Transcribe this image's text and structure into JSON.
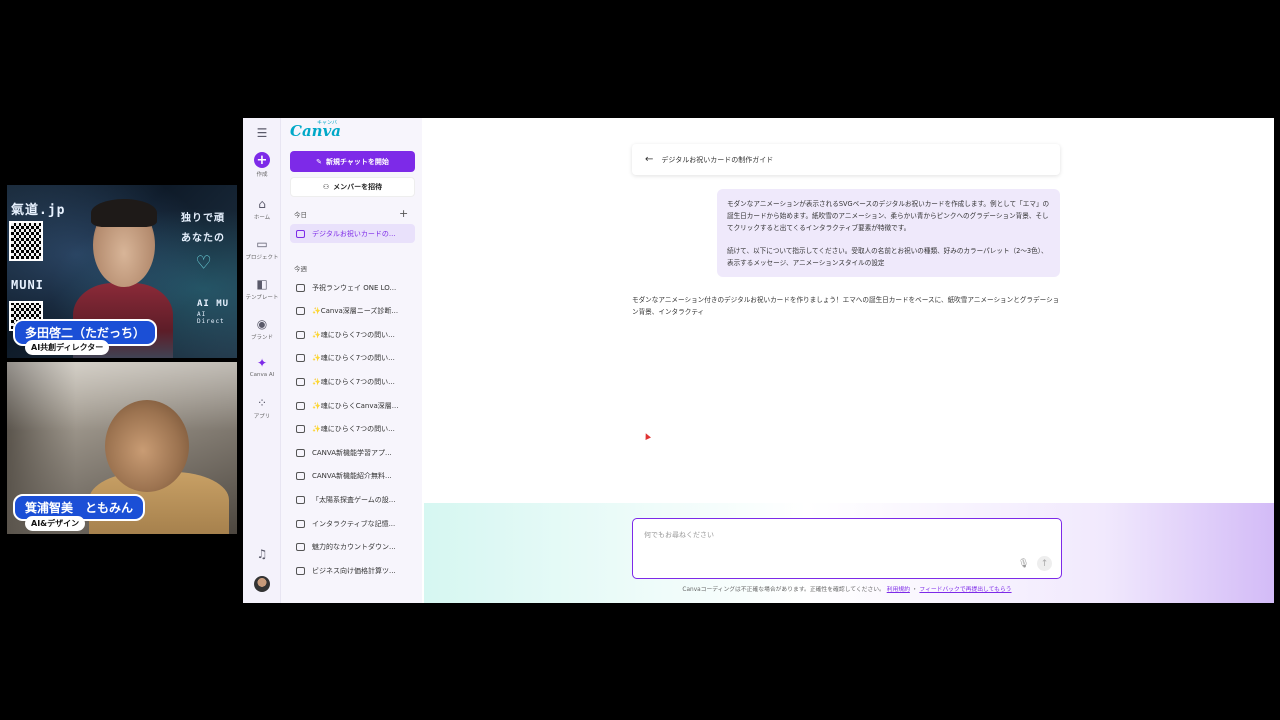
{
  "cam1": {
    "watermark_top": "氣道.jp",
    "watermark_mid": "MUNI",
    "watermark_right1": "独りで頑",
    "watermark_right2": "あなたの",
    "watermark_ai": "AI MU",
    "watermark_ai_sub": "AI Direct",
    "name": "多田啓二（ただっち）",
    "role": "AI共創ディレクター"
  },
  "cam2": {
    "name": "箕浦智美　ともみん",
    "role": "AI&デザイン"
  },
  "canva": {
    "logo": "Canva",
    "logo_kana": "キャンバ",
    "rail": [
      {
        "label": "作成",
        "icon": "plus-icon"
      },
      {
        "label": "ホーム",
        "icon": "home-icon"
      },
      {
        "label": "プロジェクト",
        "icon": "folder-icon"
      },
      {
        "label": "テンプレート",
        "icon": "template-icon"
      },
      {
        "label": "ブランド",
        "icon": "brand-icon"
      },
      {
        "label": "Canva AI",
        "icon": "sparkle-icon"
      },
      {
        "label": "アプリ",
        "icon": "apps-icon"
      }
    ],
    "new_chat": "新規チャットを開始",
    "invite": "メンバーを招待",
    "today_label": "今日",
    "week_label": "今週",
    "today_items": [
      "デジタルお祝いカードの..."
    ],
    "week_items": [
      "予祝ランウェイ ONE LO...",
      "✨Canva深層ニーズ診断...",
      "✨魂にひらく7つの問い...",
      "✨魂にひらく7つの問い...",
      "✨魂にひらく7つの問い...",
      "✨魂にひらくCanva深層...",
      "✨魂にひらく7つの問い...",
      "CANVA新機能学習アプ...",
      "CANVA新機能紹介無料...",
      "「太陽系探査ゲームの設...",
      "インタラクティブな記憶...",
      "魅力的なカウントダウン...",
      "ビジネス向け価格計算ツ..."
    ],
    "chat_title": "デジタルお祝いカードの制作ガイド",
    "user_msg_1": "モダンなアニメーションが表示されるSVGベースのデジタルお祝いカードを作成します。例として「エマ」の誕生日カードから始めます。紙吹雪のアニメーション、柔らかい青からピンクへのグラデーション背景、そしてクリックすると出てくるインタラクティブ要素が特徴です。",
    "user_msg_2": "続けて、以下について指示してください。受取人の名前とお祝いの種類、好みのカラーパレット（2〜3色）、表示するメッセージ、アニメーションスタイルの設定",
    "ai_reply": "モダンなアニメーション付きのデジタルお祝いカードを作りましょう！エマへの誕生日カードをベースに、紙吹雪アニメーションとグラデーション背景、インタラクティ",
    "composer_placeholder": "何でもお尋ねください",
    "disclaimer": "Canvaコーディングは不正確な場合があります。正確性を確認してください。",
    "terms_link": "利用規約",
    "feedback_link": "フィードバックで再提出してもらう"
  },
  "colors": {
    "accent": "#7d2ae8",
    "name_pill": "#1b4fd6",
    "logo": "#00a8c8"
  }
}
